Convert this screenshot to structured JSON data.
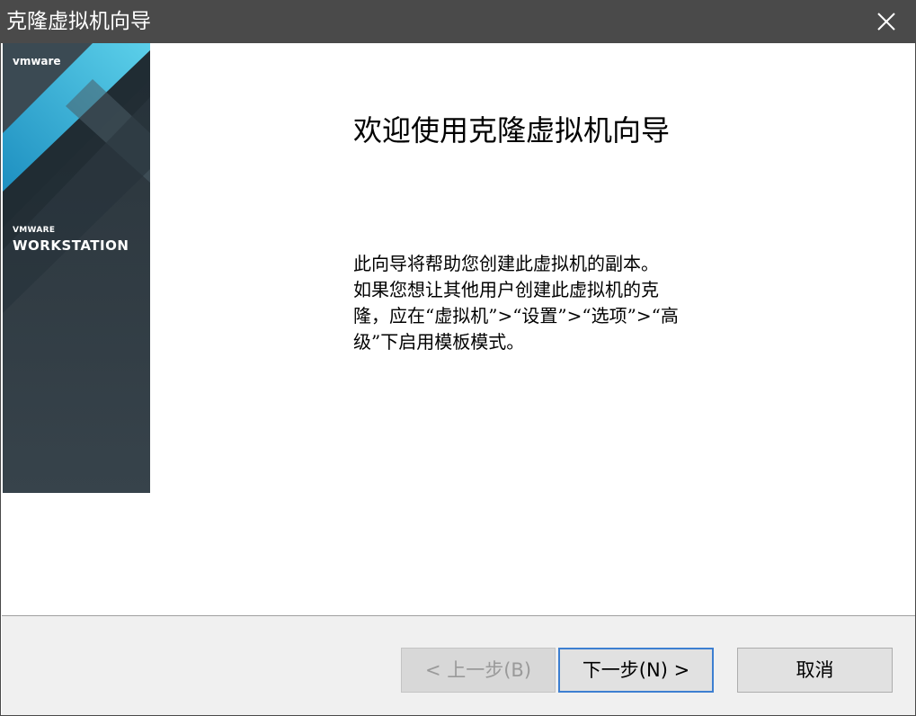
{
  "window": {
    "title": "克隆虚拟机向导"
  },
  "banner": {
    "logo": "vmware",
    "brand": "VMWARE",
    "product": "WORKSTATION"
  },
  "main": {
    "heading": "欢迎使用克隆虚拟机向导",
    "description_lines": [
      "此向导将帮助您创建此虚拟机的副本。",
      "如果您想让其他用户创建此虚拟机的克",
      "隆，应在“虚拟机”>“设置”>“选项”>“高",
      "级”下启用模板模式。"
    ]
  },
  "footer": {
    "back_label": "< 上一步(B)",
    "next_label": "下一步(N) >",
    "cancel_label": "取消"
  },
  "colors": {
    "titlebar": "#4a4a4a",
    "banner_dark": "#2f3a42",
    "banner_accent": "#3fb3d6",
    "default_button_border": "#3d7fd1"
  },
  "icons": {
    "close": "close-icon"
  }
}
